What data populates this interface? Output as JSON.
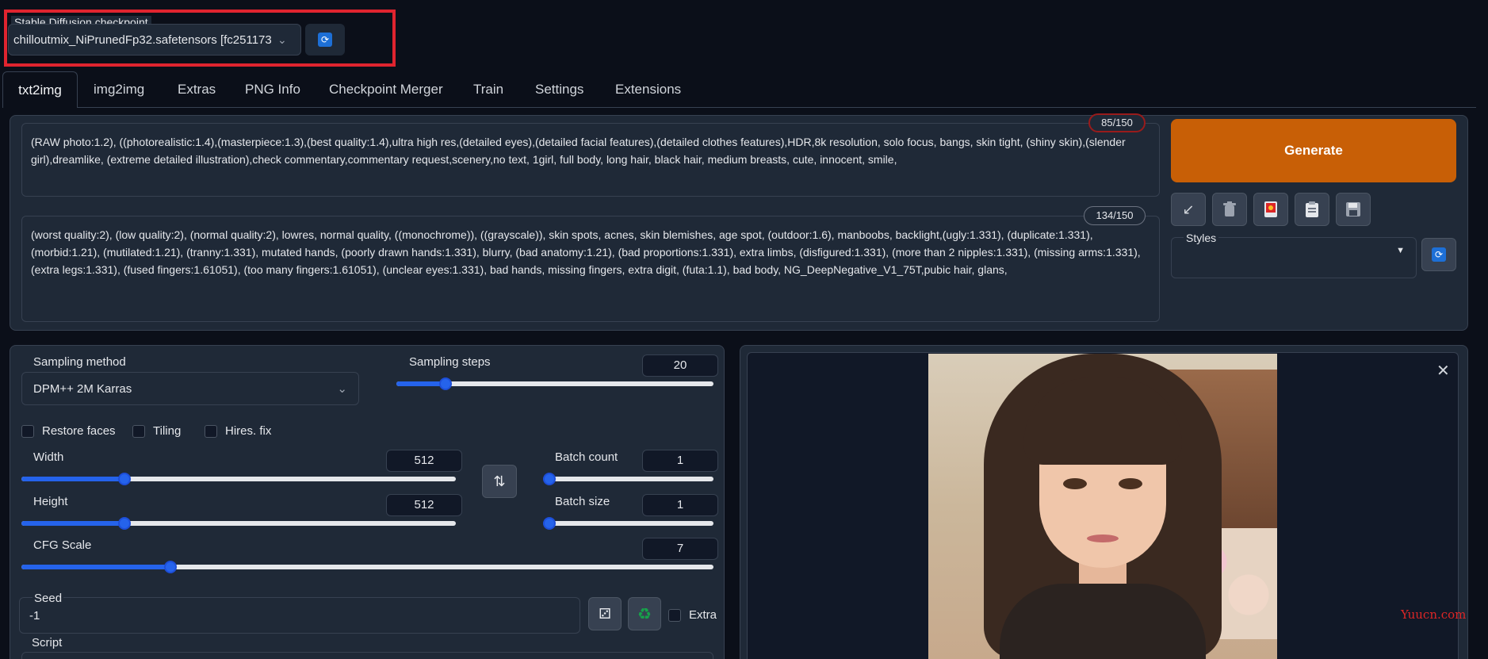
{
  "checkpoint": {
    "label": "Stable Diffusion checkpoint",
    "value": "chilloutmix_NiPrunedFp32.safetensors [fc251173",
    "refresh_icon": "refresh-icon",
    "highlight_color": "#e0242f"
  },
  "tabs": [
    "txt2img",
    "img2img",
    "Extras",
    "PNG Info",
    "Checkpoint Merger",
    "Train",
    "Settings",
    "Extensions"
  ],
  "active_tab": "txt2img",
  "prompt": {
    "token_count": "85/150",
    "text": "(RAW photo:1.2), ((photorealistic:1.4),(masterpiece:1.3),(best quality:1.4),ultra high res,(detailed eyes),(detailed facial features),(detailed clothes features),HDR,8k resolution, solo focus, bangs, skin tight, (shiny skin),(slender girl),dreamlike, (extreme detailed illustration),check commentary,commentary request,scenery,no text, 1girl, full body, long hair, black hair, medium breasts, cute, innocent, smile,"
  },
  "negative_prompt": {
    "token_count": "134/150",
    "text": "(worst quality:2), (low quality:2), (normal quality:2), lowres, normal quality, ((monochrome)), ((grayscale)), skin spots, acnes, skin blemishes, age spot, (outdoor:1.6), manboobs, backlight,(ugly:1.331), (duplicate:1.331), (morbid:1.21), (mutilated:1.21), (tranny:1.331), mutated hands, (poorly drawn hands:1.331), blurry, (bad anatomy:1.21), (bad proportions:1.331), extra limbs, (disfigured:1.331), (more than 2 nipples:1.331), (missing arms:1.331), (extra legs:1.331), (fused fingers:1.61051), (too many fingers:1.61051), (unclear eyes:1.331), bad hands, missing fingers, extra digit, (futa:1.1), bad body, NG_DeepNegative_V1_75T,pubic hair, glans,"
  },
  "generate": {
    "label": "Generate",
    "color": "#c85f06"
  },
  "tool_icons": [
    "arrow-icon",
    "trash-icon",
    "card-icon",
    "clipboard-icon",
    "save-icon"
  ],
  "styles": {
    "label": "Styles"
  },
  "sampling": {
    "method_label": "Sampling method",
    "method_value": "DPM++ 2M Karras",
    "steps_label": "Sampling steps",
    "steps_value": "20",
    "steps_fraction": 0.14
  },
  "checkboxes": [
    "Restore faces",
    "Tiling",
    "Hires. fix"
  ],
  "width": {
    "label": "Width",
    "value": "512",
    "fraction": 0.23
  },
  "height": {
    "label": "Height",
    "value": "512",
    "fraction": 0.23
  },
  "batch_count": {
    "label": "Batch count",
    "value": "1",
    "fraction": 0.0
  },
  "batch_size": {
    "label": "Batch size",
    "value": "1",
    "fraction": 0.0
  },
  "cfg": {
    "label": "CFG Scale",
    "value": "7",
    "fraction": 0.21
  },
  "seed": {
    "label": "Seed",
    "value": "-1",
    "extra_label": "Extra"
  },
  "script": {
    "label": "Script"
  },
  "watermark": "Yuucn.com",
  "accent_color": "#2563eb"
}
